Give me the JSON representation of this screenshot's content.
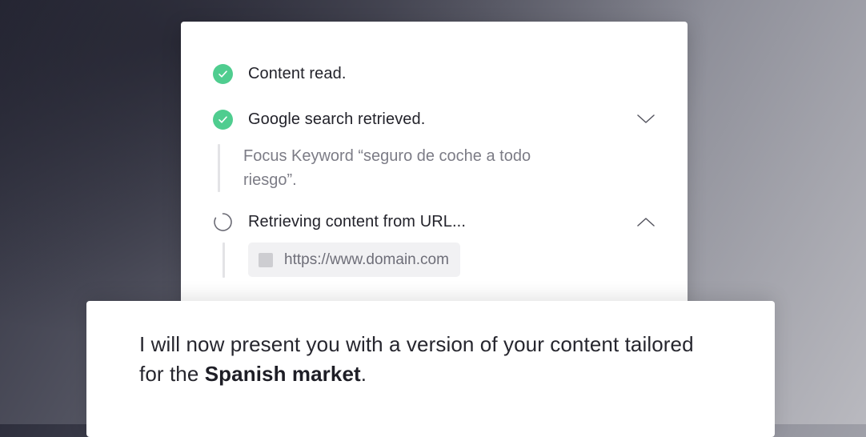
{
  "steps": [
    {
      "status": "done",
      "label": "Content read.",
      "expanded": false
    },
    {
      "status": "done",
      "label": "Google search retrieved.",
      "expanded": true,
      "chevron": "chevron-down-icon",
      "detail": "Focus Keyword “seguro de coche a todo riesgo”."
    },
    {
      "status": "loading",
      "label": "Retrieving content from URL...",
      "expanded": true,
      "chevron": "chevron-up-icon",
      "url": "https://www.domain.com"
    }
  ],
  "message": {
    "prefix": "I will now present you with a version of your content tailored for the ",
    "emphasis": "Spanish market",
    "suffix": "."
  },
  "colors": {
    "success": "#4fcd8f",
    "text": "#23232b",
    "muted": "#7c7c86"
  }
}
